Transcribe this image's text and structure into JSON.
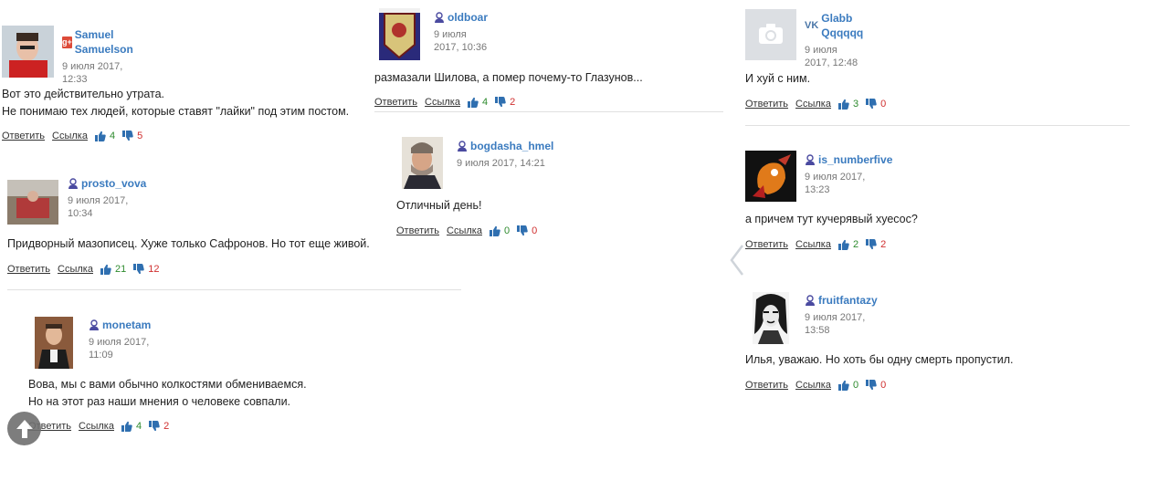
{
  "actions": {
    "reply": "Ответить",
    "link": "Ссылка"
  },
  "colors": {
    "author": "#3b7bbf",
    "like": "#2e8b2e",
    "dislike": "#d03030",
    "thumb": "#2f6fb0"
  },
  "comments": [
    {
      "author": "Samuel Samuelson",
      "network": "gplus-icon",
      "date": "9 июля 2017, 12:33",
      "lines": [
        "Вот это действительно утрата.",
        "Не понимаю тех людей, которые ставят \"лайки\" под этим постом."
      ],
      "likes": "4",
      "dislikes": "5"
    },
    {
      "author": "prosto_vova",
      "network": "user-icon",
      "date": "9 июля 2017, 10:34",
      "lines": [
        "Придворный мазописец. Хуже только Сафронов. Но тот еще живой."
      ],
      "likes": "21",
      "dislikes": "12"
    },
    {
      "author": "monetam",
      "network": "user-icon",
      "date": "9 июля 2017, 11:09",
      "lines": [
        "Вова, мы с вами обычно колкостями обмениваемся.",
        "Но на этот раз наши мнения о человеке совпали."
      ],
      "likes": "4",
      "dislikes": "2"
    },
    {
      "author": "oldboar",
      "network": "user-icon",
      "date": "9 июля 2017, 10:36",
      "lines": [
        "размазали Шилова, а помер почему-то Глазунов..."
      ],
      "likes": "4",
      "dislikes": "2"
    },
    {
      "author": "bogdasha_hmel",
      "network": "user-icon",
      "date": "9 июля 2017, 14:21",
      "lines": [
        "Отличный день!"
      ],
      "likes": "0",
      "dislikes": "0"
    },
    {
      "author": "Glabb Qqqqqq",
      "network": "vk-icon",
      "date": "9 июля 2017, 12:48",
      "lines": [
        "И хуй с ним."
      ],
      "likes": "3",
      "dislikes": "0"
    },
    {
      "author": "is_numberfive",
      "network": "user-icon",
      "date": "9 июля 2017, 13:23",
      "lines": [
        "а причем тут кучерявый хуесос?"
      ],
      "likes": "2",
      "dislikes": "2"
    },
    {
      "author": "fruitfantazy",
      "network": "user-icon",
      "date": "9 июля 2017, 13:58",
      "lines": [
        "Илья, уважаю. Но хоть бы одну смерть пропустил."
      ],
      "likes": "0",
      "dislikes": "0"
    }
  ]
}
